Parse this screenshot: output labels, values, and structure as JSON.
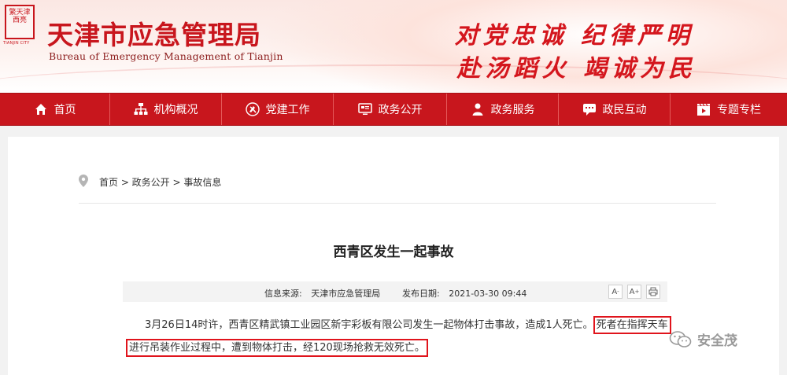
{
  "header": {
    "seal_text": "繁天津 西亮",
    "seal_sub": "TIANJIN CITY",
    "title_cn": "天津市应急管理局",
    "title_en": "Bureau  of Emergency Management of Tianjin",
    "slogan_line1": "对党忠诚  纪律严明",
    "slogan_line2": "赴汤蹈火  竭诚为民",
    "accent_color": "#c8161d"
  },
  "nav": {
    "items": [
      {
        "label": "首页",
        "icon": "home-icon"
      },
      {
        "label": "机构概况",
        "icon": "org-chart-icon"
      },
      {
        "label": "党建工作",
        "icon": "party-emblem-icon"
      },
      {
        "label": "政务公开",
        "icon": "monitor-icon"
      },
      {
        "label": "政务服务",
        "icon": "person-icon"
      },
      {
        "label": "政民互动",
        "icon": "chat-icon"
      },
      {
        "label": "专题专栏",
        "icon": "film-icon"
      }
    ]
  },
  "breadcrumb": {
    "icon": "location-pin-icon",
    "text": "首页 > 政务公开 > 事故信息"
  },
  "article": {
    "title": "西青区发生一起事故",
    "source_label": "信息来源:",
    "source_value": "天津市应急管理局",
    "date_label": "发布日期:",
    "date_value": "2021-03-30 09:44",
    "tools": [
      "A-",
      "A+",
      "print"
    ],
    "line1_plain": "3月26日14时许，西青区精武镇工业园区新宇彩板有限公司发生一起物体打击事故，造成1人死亡。",
    "line1_highlight": "死者在指挥天车",
    "line2_highlight": "进行吊装作业过程中，遭到物体打击，经120现场抢救无效死亡。",
    "highlight_color": "#e0141c"
  },
  "watermark": {
    "text": "安全茂",
    "icon": "wechat-icon"
  }
}
